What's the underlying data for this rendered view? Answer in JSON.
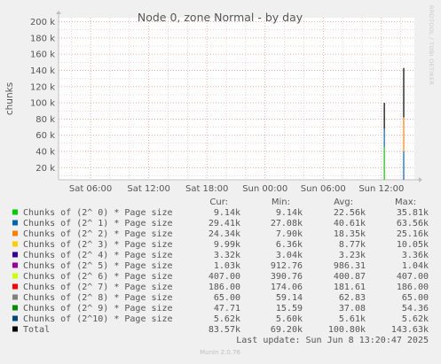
{
  "chart_data": {
    "type": "line",
    "title": "Node 0, zone Normal - by day",
    "ylabel": "chunks",
    "watermark": "RRDTOOL / TOBI OETIKER",
    "footer": "Munin 2.0.76",
    "last_update": "Last update: Sun Jun  8 13:20:47 2025",
    "ylim": [
      5000,
      205000
    ],
    "ytick_values": [
      20000,
      40000,
      60000,
      80000,
      100000,
      120000,
      140000,
      160000,
      180000,
      200000
    ],
    "ytick_labels": [
      "20 k",
      "40 k",
      "60 k",
      "80 k",
      "100 k",
      "120 k",
      "140 k",
      "160 k",
      "180 k",
      "200 k"
    ],
    "x_ticks": [
      {
        "label": "Sat 06:00",
        "hour": 6
      },
      {
        "label": "Sat 12:00",
        "hour": 12
      },
      {
        "label": "Sat 18:00",
        "hour": 18
      },
      {
        "label": "Sun 00:00",
        "hour": 24
      },
      {
        "label": "Sun 06:00",
        "hour": 30
      },
      {
        "label": "Sun 12:00",
        "hour": 36
      }
    ],
    "xlim_hours": [
      2.7,
      39.4
    ],
    "grid": true,
    "legend_headers": [
      "Cur:",
      "Min:",
      "Avg:",
      "Max:"
    ],
    "series": [
      {
        "name": "Chunks of (2^ 0) * Page size",
        "color": "#00cc00",
        "cur": "9.14k",
        "min": "9.14k",
        "avg": "22.56k",
        "max": "35.81k"
      },
      {
        "name": "Chunks of (2^ 1) * Page size",
        "color": "#0066b3",
        "cur": "29.41k",
        "min": "27.08k",
        "avg": "40.61k",
        "max": "63.56k"
      },
      {
        "name": "Chunks of (2^ 2) * Page size",
        "color": "#ff8000",
        "cur": "24.34k",
        "min": "7.90k",
        "avg": "18.35k",
        "max": "25.16k"
      },
      {
        "name": "Chunks of (2^ 3) * Page size",
        "color": "#ffcc00",
        "cur": "9.99k",
        "min": "6.36k",
        "avg": "8.77k",
        "max": "10.05k"
      },
      {
        "name": "Chunks of (2^ 4) * Page size",
        "color": "#330099",
        "cur": "3.32k",
        "min": "3.04k",
        "avg": "3.23k",
        "max": "3.36k"
      },
      {
        "name": "Chunks of (2^ 5) * Page size",
        "color": "#990099",
        "cur": "1.03k",
        "min": "912.76",
        "avg": "986.31",
        "max": "1.04k"
      },
      {
        "name": "Chunks of (2^ 6) * Page size",
        "color": "#ccff00",
        "cur": "407.00",
        "min": "390.76",
        "avg": "400.87",
        "max": "407.00"
      },
      {
        "name": "Chunks of (2^ 7) * Page size",
        "color": "#ff0000",
        "cur": "186.00",
        "min": "174.06",
        "avg": "181.61",
        "max": "186.00"
      },
      {
        "name": "Chunks of (2^ 8) * Page size",
        "color": "#808080",
        "cur": "65.00",
        "min": "59.14",
        "avg": "62.83",
        "max": "65.00"
      },
      {
        "name": "Chunks of (2^ 9) * Page size",
        "color": "#008f00",
        "cur": "47.71",
        "min": "15.59",
        "avg": "37.08",
        "max": "54.36"
      },
      {
        "name": "Chunks of (2^10) * Page size",
        "color": "#00487d",
        "cur": "5.62k",
        "min": "5.60k",
        "avg": "5.61k",
        "max": "5.62k"
      },
      {
        "name": "Total",
        "color": "#000000",
        "cur": "83.57k",
        "min": "69.20k",
        "avg": "100.80k",
        "max": "143.63k"
      }
    ],
    "data_bursts": [
      {
        "hour": 36.3,
        "segments": [
          {
            "color": "#00cc00",
            "from": 5000,
            "to": 45000
          },
          {
            "color": "#0066b3",
            "from": 45000,
            "to": 68000
          },
          {
            "color": "#000000",
            "from": 68000,
            "to": 100000
          }
        ]
      },
      {
        "hour": 38.3,
        "segments": [
          {
            "color": "#0066b3",
            "from": 5000,
            "to": 40000
          },
          {
            "color": "#ff8000",
            "from": 40000,
            "to": 82000
          },
          {
            "color": "#000000",
            "from": 82000,
            "to": 143000
          }
        ]
      }
    ]
  }
}
